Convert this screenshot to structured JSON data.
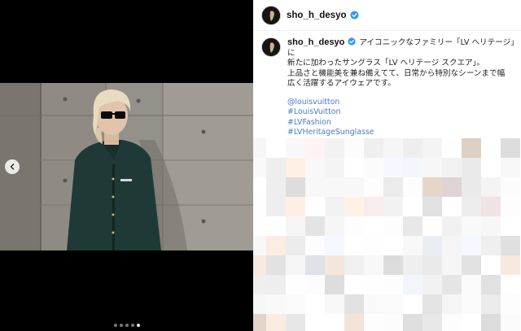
{
  "post": {
    "username": "sho_h_desyo",
    "verified_badge_icon": "verified-check-icon",
    "caption_lines": [
      "アイコニックなファミリー「LV ヘリテージ」に",
      "新たに加わったサングラス「LV ヘリテージ スクエア」。",
      "上品さと機能美を兼ね備えてて、日常から特別なシーンまで幅",
      "広く活躍するアイウェアです。"
    ],
    "hashtags": [
      "@louisvuitton",
      "#LouisVuitton",
      "#LVFashion",
      "#LVHeritageSunglasse"
    ]
  },
  "media": {
    "prev_icon": "chevron-left-icon",
    "carousel_count": 5,
    "active_index": 4
  },
  "colors": {
    "link": "#4a7cc7",
    "verified": "#3897f0"
  }
}
